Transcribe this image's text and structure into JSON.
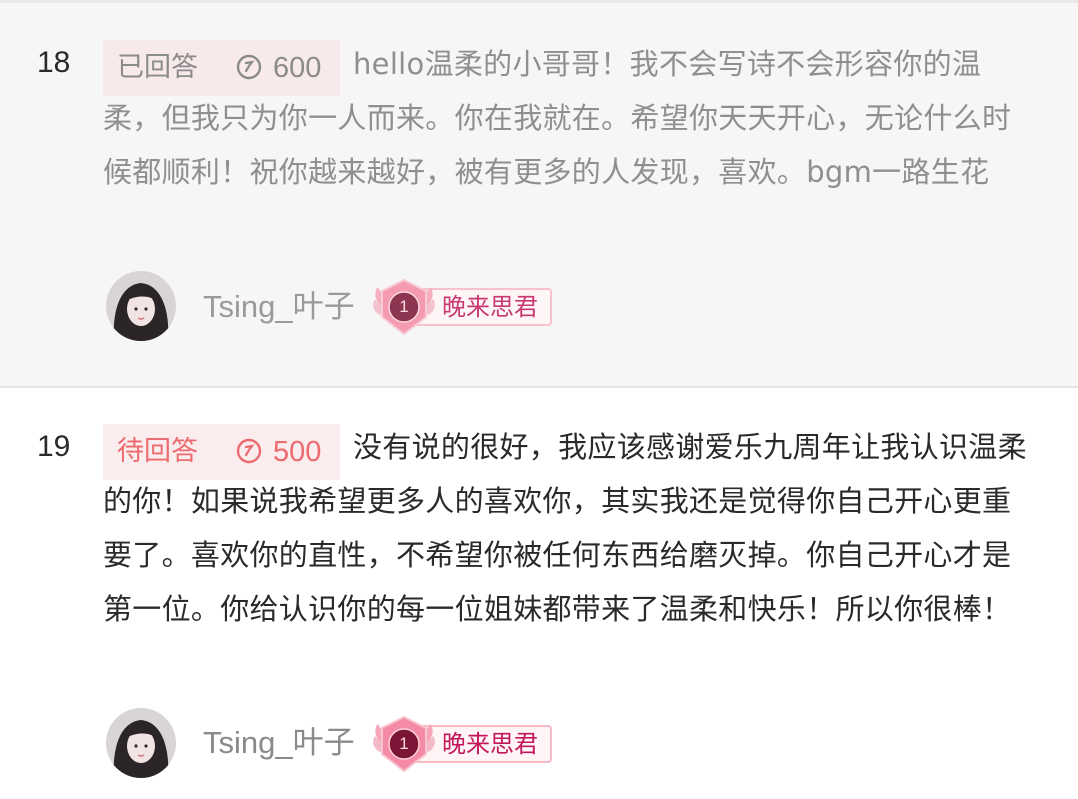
{
  "answers": [
    {
      "number": "18",
      "status": "已回答",
      "reward": "600",
      "text": "hello温柔的小哥哥！我不会写诗不会形容你的温柔，但我只为你一人而来。你在我就在。希望你天天开心，无论什么时候都顺利！祝你越来越好，被有更多的人发现，喜欢。bgm一路生花",
      "user": {
        "name": "Tsing_叶子",
        "badge_level": "1",
        "badge_title": "晚来思君"
      }
    },
    {
      "number": "19",
      "status": "待回答",
      "reward": "500",
      "text": "没有说的很好，我应该感谢爱乐九周年让我认识温柔的你！如果说我希望更多人的喜欢你，其实我还是觉得你自己开心更重要了。喜欢你的直性，不希望你被任何东西给磨灭掉。你自己开心才是第一位。你给认识你的每一位姐妹都带来了温柔和快乐！所以你很棒！",
      "user": {
        "name": "Tsing_叶子",
        "badge_level": "1",
        "badge_title": "晚来思君"
      }
    }
  ],
  "colors": {
    "answered_tag_text": "#8b8b8b",
    "pending_tag_text": "#ec6a70",
    "badge_text": "#c2185b"
  },
  "icons": {
    "reward": "coin-icon",
    "badge": "winged-badge-icon"
  }
}
